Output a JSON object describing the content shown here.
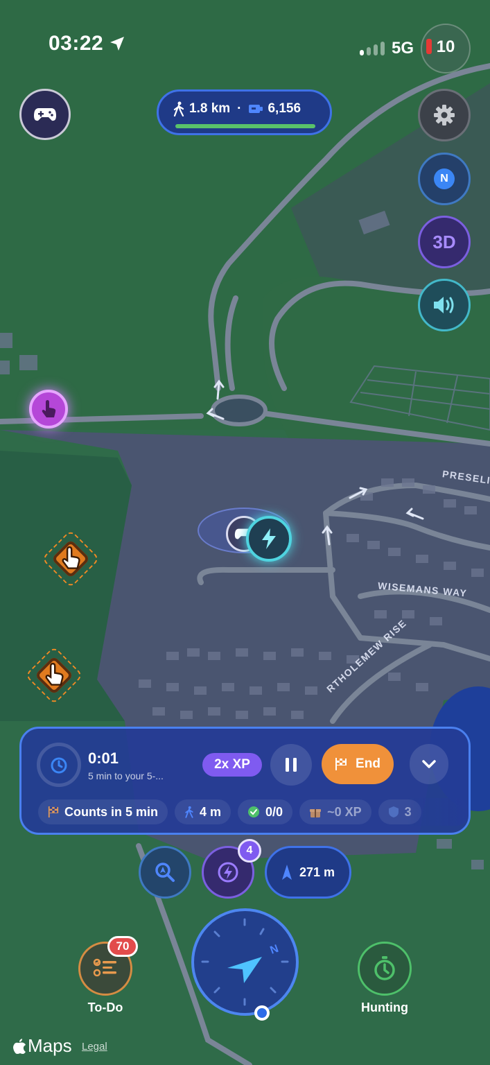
{
  "status_bar": {
    "time": "03:22",
    "network": "5G",
    "battery_level": "10"
  },
  "top_stats": {
    "distance": "1.8 km",
    "separator": "·",
    "steps": "6,156",
    "progress_fraction": 1.0
  },
  "map_controls": {
    "north_label": "N",
    "threed_label": "3D"
  },
  "road_labels": {
    "preseli": "PRESELI",
    "wisemans": "WISEMANS WAY",
    "bartholomew": "RTHOLEMEW RISE"
  },
  "session": {
    "elapsed": "0:01",
    "subtitle": "5 min to your 5-...",
    "xp_multiplier": "2x XP",
    "end_label": "End",
    "chips": {
      "counts": "Counts in 5 min",
      "walk": "4 m",
      "tasks": "0/0",
      "xp": "~0 XP",
      "extra": "3"
    }
  },
  "quick_controls": {
    "bolt_count": "4",
    "distance": "271 m"
  },
  "bottom_nav": {
    "todo_label": "To-Do",
    "todo_count": "70",
    "hunting_label": "Hunting"
  },
  "attribution": {
    "maps": "Maps",
    "legal": "Legal"
  },
  "colors": {
    "accent_blue": "#3f72e8",
    "xp_purple": "#7f5bf0",
    "end_orange": "#f0913a",
    "progress_green": "#59c26a",
    "badge_red": "#e24b4b"
  }
}
